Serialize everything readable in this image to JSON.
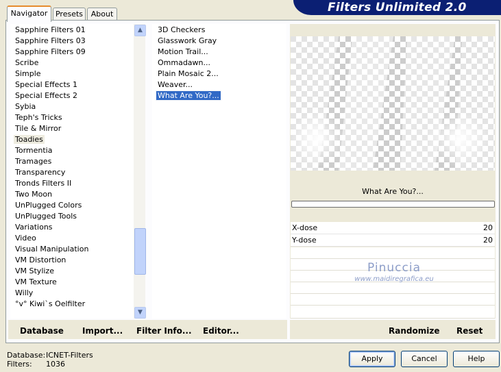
{
  "app": {
    "title": "Filters Unlimited 2.0"
  },
  "tabs": [
    {
      "label": "Navigator",
      "active": true
    },
    {
      "label": "Presets",
      "active": false
    },
    {
      "label": "About",
      "active": false
    }
  ],
  "categories": [
    "Sapphire Filters 01",
    "Sapphire Filters 03",
    "Sapphire Filters 09",
    "Scribe",
    "Simple",
    "Special Effects 1",
    "Special Effects 2",
    "Sybia",
    "Teph's Tricks",
    "Tile & Mirror",
    "Toadies",
    "Tormentia",
    "Tramages",
    "Transparency",
    "Tronds Filters II",
    "Two Moon",
    "UnPlugged Colors",
    "UnPlugged Tools",
    "Variations",
    "Video",
    "Visual Manipulation",
    "VM Distortion",
    "VM Stylize",
    "VM Texture",
    "Willy",
    "°v° Kiwi`s Oelfilter"
  ],
  "selected_category": "Toadies",
  "filters": [
    "3D Checkers",
    "Glasswork Gray",
    "Motion Trail...",
    "Ommadawn...",
    "Plain Mosaic 2...",
    "Weaver...",
    "What Are You?..."
  ],
  "selected_filter": "What Are You?...",
  "preview": {
    "filter_name": "What Are You?..."
  },
  "params": [
    {
      "label": "X-dose",
      "value": "20"
    },
    {
      "label": "Y-dose",
      "value": "20"
    }
  ],
  "watermark": {
    "name": "Pinuccia",
    "url": "www.maidiregrafica.eu"
  },
  "toolbar": {
    "database": "Database",
    "import": "Import...",
    "filter_info": "Filter Info...",
    "editor": "Editor...",
    "randomize": "Randomize",
    "reset": "Reset"
  },
  "status": {
    "database_label": "Database:",
    "database_value": "ICNET-Filters",
    "filters_label": "Filters:",
    "filters_value": "1036"
  },
  "buttons": {
    "apply": "Apply",
    "cancel": "Cancel",
    "help": "Help"
  },
  "colors": {
    "banner": "#0b1f73",
    "selection": "#3169c6",
    "dialog": "#ece9d8"
  },
  "scrollbar": {
    "position_fraction": 0.85
  }
}
